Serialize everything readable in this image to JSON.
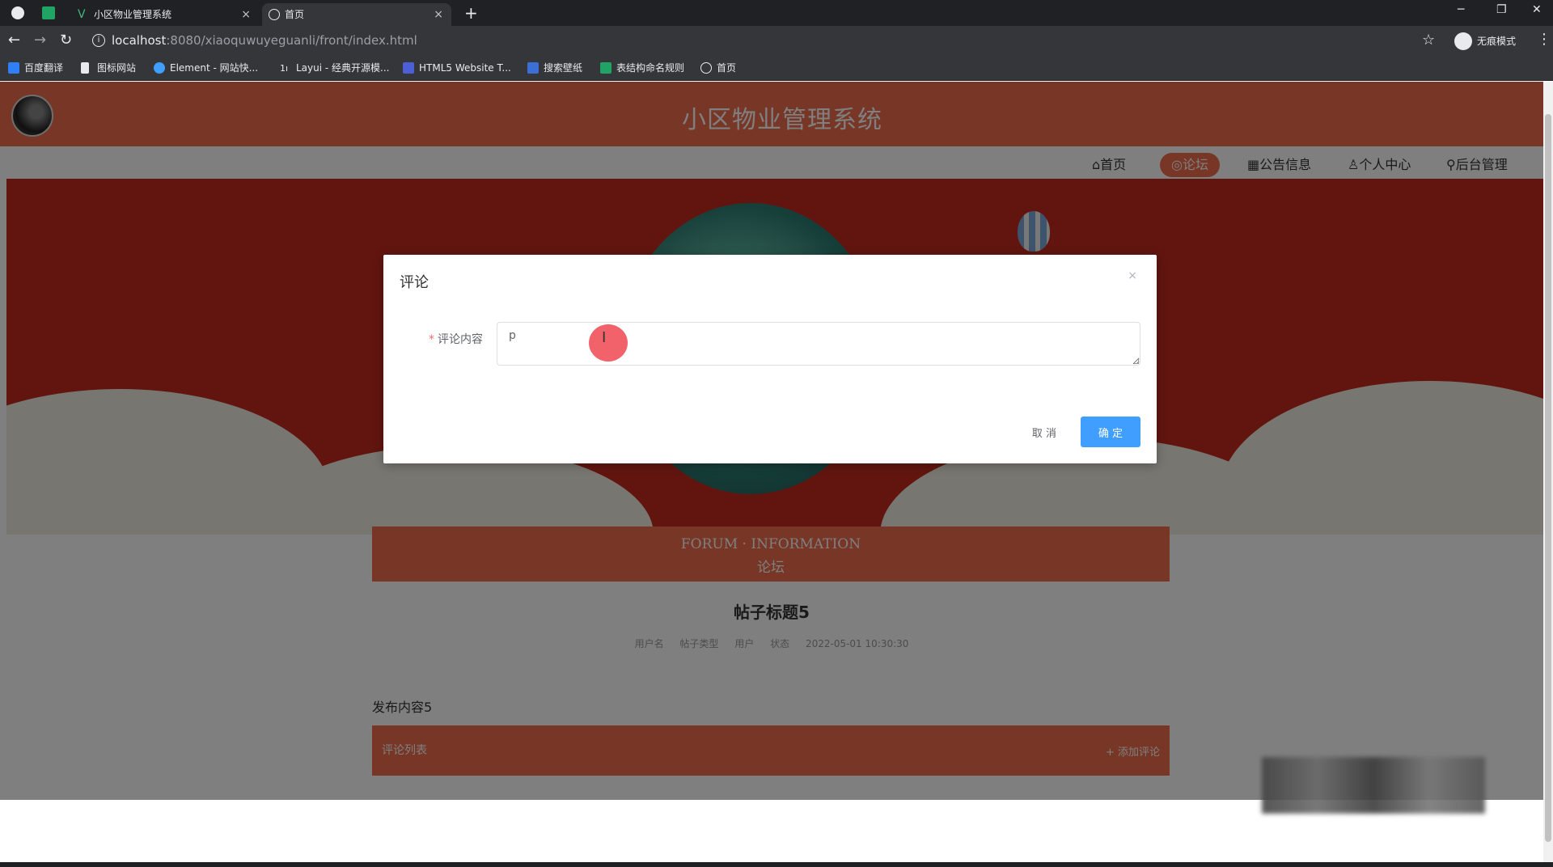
{
  "browser": {
    "tabs": [
      {
        "title": "小区物业管理系统"
      },
      {
        "title": "首页"
      }
    ],
    "tab_close": "×",
    "new_tab": "+",
    "window_controls": {
      "minimize": "─",
      "restore": "❐",
      "close": "✕"
    },
    "nav": {
      "back": "←",
      "forward": "→",
      "reload": "↻"
    },
    "url": {
      "host": "localhost",
      "rest": ":8080/xiaoquwuyeguanli/front/index.html"
    },
    "star": "☆",
    "profile_label": "无痕模式",
    "menu": "⋮",
    "bookmarks": [
      {
        "label": "百度翻译",
        "color": "#2f7ff7"
      },
      {
        "label": "图标网站",
        "color": "#e8eaed"
      },
      {
        "label": "Element - 网站快...",
        "color": "#409eff"
      },
      {
        "label": "Layui - 经典开源模...",
        "color": "#e8eaed"
      },
      {
        "label": "HTML5 Website T...",
        "color": "#4c5fd5"
      },
      {
        "label": "搜索壁纸",
        "color": "#3b6fd6"
      },
      {
        "label": "表结构命名规则",
        "color": "#21a366"
      },
      {
        "label": "首页",
        "color": "#e8eaed"
      }
    ]
  },
  "site": {
    "title": "小区物业管理系统",
    "accent": "#ee6d4d",
    "nav": [
      {
        "icon": "home-icon",
        "label": "⌂首页"
      },
      {
        "icon": "forum-icon",
        "label": "◎论坛",
        "active": true
      },
      {
        "icon": "notice-icon",
        "label": "▦公告信息"
      },
      {
        "icon": "user-icon",
        "label": "♙个人中心"
      },
      {
        "icon": "link-icon",
        "label": "⚲后台管理"
      }
    ]
  },
  "section": {
    "title_en": "FORUM · INFORMATION",
    "title_cn": "论坛"
  },
  "post": {
    "title": "帖子标题5",
    "meta": [
      "用户名",
      "帖子类型",
      "用户",
      "状态",
      "2022-05-01 10:30:30"
    ],
    "content": "发布内容5",
    "comment_bar_label": "评论列表",
    "comment_bar_button": "+ 添加评论"
  },
  "dialog": {
    "title": "评论",
    "close": "×",
    "field_required": "*",
    "field_label": "评论内容",
    "field_value": "p",
    "cancel_label": "取 消",
    "ok_label": "确 定",
    "ok_color": "#409eff"
  }
}
